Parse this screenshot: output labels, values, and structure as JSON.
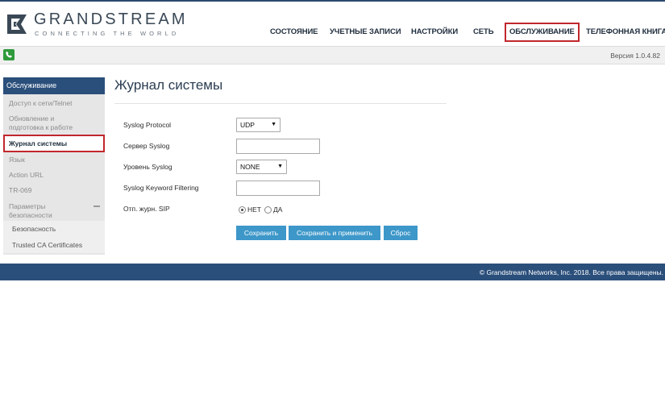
{
  "brand": {
    "name": "GRANDSTREAM",
    "tagline": "CONNECTING THE WORLD"
  },
  "nav": {
    "items": [
      "СОСТОЯНИЕ",
      "УЧЕТНЫЕ ЗАПИСИ",
      "НАСТРОЙКИ",
      "СЕТЬ",
      "ОБСЛУЖИВАНИЕ",
      "ТЕЛЕФОННАЯ КНИГА"
    ],
    "active": "ОБСЛУЖИВАНИЕ"
  },
  "subbar": {
    "version": "Версия 1.0.4.82"
  },
  "sidebar": {
    "header": "Обслуживание",
    "items": [
      "Доступ к сети/Telnet",
      "Обновление и подготовка к работе",
      "Журнал системы",
      "Язык",
      "Action URL",
      "TR-069",
      "Параметры безопасности"
    ],
    "sub_items": [
      "Безопасность",
      "Trusted CA Certificates"
    ]
  },
  "main": {
    "title": "Журнал системы",
    "fields": {
      "protocol_label": "Syslog Protocol",
      "protocol_value": "UDP",
      "server_label": "Сервер Syslog",
      "server_value": "",
      "level_label": "Уровень Syslog",
      "level_value": "NONE",
      "keyword_label": "Syslog Keyword Filtering",
      "keyword_value": "",
      "sip_label": "Отп. журн. SIP",
      "sip_no": "НЕТ",
      "sip_yes": "ДА",
      "sip_selected": "НЕТ"
    },
    "buttons": {
      "save": "Сохранить",
      "save_apply": "Сохранить и применить",
      "reset": "Сброс"
    }
  },
  "footer": {
    "copyright": "© Grandstream Networks, Inc. 2018. Все права защищены."
  },
  "colors": {
    "brand_blue": "#2b4f7b",
    "button_blue": "#3d97c9",
    "highlight_red": "#c1272d",
    "phone_green": "#2f9a3c"
  }
}
